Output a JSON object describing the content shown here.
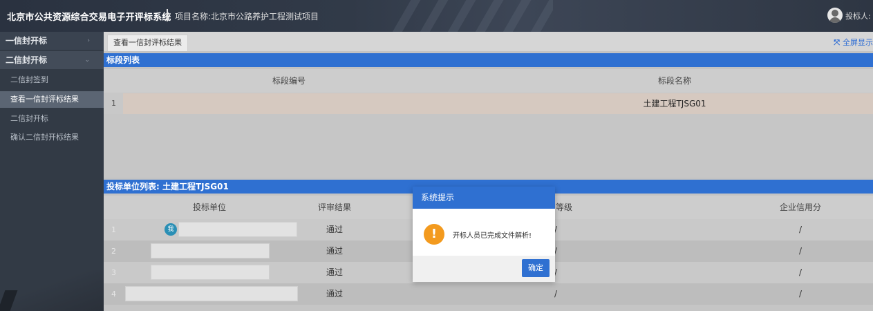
{
  "header": {
    "system_title": "北京市公共资源综合交易电子开评标系统",
    "project_label": "项目名称:北京市公路养护工程测试项目",
    "user_label": "投标人:"
  },
  "sidebar": {
    "groups": [
      {
        "label": "一信封开标",
        "expanded": false
      },
      {
        "label": "二信封开标",
        "expanded": true
      }
    ],
    "items": [
      {
        "label": "二信封签到",
        "active": false
      },
      {
        "label": "查看一信封评标结果",
        "active": true
      },
      {
        "label": "二信封开标",
        "active": false
      },
      {
        "label": "确认二信封开标结果",
        "active": false
      }
    ]
  },
  "tabs": [
    {
      "label": "查看一信封评标结果"
    }
  ],
  "fullscreen_label": "全屏显示",
  "section_list": {
    "title": "标段列表",
    "columns": [
      "标段编号",
      "标段名称"
    ],
    "rows": [
      {
        "index": "1",
        "code": "",
        "name": "土建工程TJSG01"
      }
    ]
  },
  "bidders": {
    "title": "投标单位列表: 土建工程TJSG01",
    "columns": [
      "投标单位",
      "评审结果",
      "信用等级",
      "企业信用分"
    ],
    "rows": [
      {
        "index": "1",
        "unit_badge": "我",
        "result": "通过",
        "level": "/",
        "score": "/"
      },
      {
        "index": "2",
        "result": "通过",
        "level": "/",
        "score": "/"
      },
      {
        "index": "3",
        "result": "通过",
        "level": "/",
        "score": "/"
      },
      {
        "index": "4",
        "result": "通过",
        "level": "/",
        "score": "/"
      }
    ]
  },
  "modal": {
    "title": "系统提示",
    "message": "开标人员已完成文件解析!",
    "ok_label": "确定"
  },
  "colors": {
    "accent": "#2f70d1",
    "warning": "#f39a1e"
  }
}
